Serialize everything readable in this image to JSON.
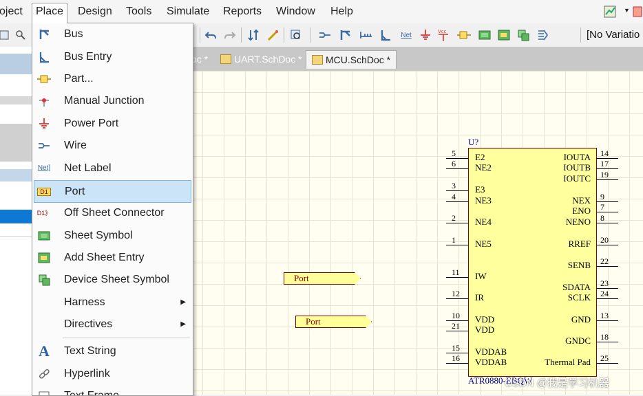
{
  "menubar": {
    "items": [
      "oject",
      "Place",
      "Design",
      "Tools",
      "Simulate",
      "Reports",
      "Window",
      "Help"
    ],
    "active": "Place"
  },
  "toolbar": {
    "variation_label": "[No Variatio"
  },
  "tabs": [
    {
      "label": "oc *",
      "active": false
    },
    {
      "label": "UART.SchDoc *",
      "active": false
    },
    {
      "label": "MCU.SchDoc *",
      "active": true
    }
  ],
  "place_menu": {
    "items": [
      {
        "label": "Bus",
        "icon": "bus-icon",
        "has_submenu": false
      },
      {
        "label": "Bus Entry",
        "icon": "bus-entry-icon",
        "has_submenu": false
      },
      {
        "label": "Part...",
        "icon": "part-icon",
        "has_submenu": false
      },
      {
        "label": "Manual Junction",
        "icon": "junction-icon",
        "has_submenu": false
      },
      {
        "label": "Power Port",
        "icon": "power-port-icon",
        "has_submenu": false
      },
      {
        "label": "Wire",
        "icon": "wire-icon",
        "has_submenu": false
      },
      {
        "label": "Net Label",
        "icon": "net-label-icon",
        "icon_text": "Net]",
        "has_submenu": false
      },
      {
        "label": "Port",
        "icon": "port-icon",
        "icon_text": "D1",
        "has_submenu": false,
        "highlighted": true
      },
      {
        "label": "Off Sheet Connector",
        "icon": "off-sheet-connector-icon",
        "icon_text": "D1》",
        "has_submenu": false
      },
      {
        "label": "Sheet Symbol",
        "icon": "sheet-symbol-icon",
        "has_submenu": false
      },
      {
        "label": "Add Sheet Entry",
        "icon": "sheet-entry-icon",
        "has_submenu": false
      },
      {
        "label": "Device Sheet Symbol",
        "icon": "device-sheet-symbol-icon",
        "has_submenu": false
      },
      {
        "label": "Harness",
        "icon": "",
        "has_submenu": true
      },
      {
        "label": "Directives",
        "icon": "",
        "has_submenu": true
      },
      {
        "label": "Text String",
        "icon": "text-string-icon",
        "icon_text": "A",
        "has_submenu": false
      },
      {
        "label": "Hyperlink",
        "icon": "hyperlink-icon",
        "has_submenu": false
      },
      {
        "label": "Text Frame",
        "icon": "text-frame-icon",
        "has_submenu": false
      }
    ]
  },
  "ports": [
    "Port",
    "Port"
  ],
  "component": {
    "designator": "U?",
    "part_name": "ATR0880-EBQW",
    "left_pins": [
      {
        "num": "5",
        "name": "E2"
      },
      {
        "num": "6",
        "name": "NE2"
      },
      {
        "num": "3",
        "name": "E3"
      },
      {
        "num": "4",
        "name": "NE3"
      },
      {
        "num": "2",
        "name": "NE4"
      },
      {
        "num": "1",
        "name": "NE5"
      },
      {
        "num": "11",
        "name": "IW"
      },
      {
        "num": "12",
        "name": "IR"
      },
      {
        "num": "10",
        "name": "VDD"
      },
      {
        "num": "21",
        "name": "VDD"
      },
      {
        "num": "15",
        "name": "VDDAB"
      },
      {
        "num": "16",
        "name": "VDDAB"
      }
    ],
    "right_pins": [
      {
        "num": "14",
        "name": "IOUTA"
      },
      {
        "num": "17",
        "name": "IOUTB"
      },
      {
        "num": "19",
        "name": "IOUTC"
      },
      {
        "num": "9",
        "name": "NEX"
      },
      {
        "num": "7",
        "name": "ENO"
      },
      {
        "num": "8",
        "name": "NENO"
      },
      {
        "num": "20",
        "name": "RREF"
      },
      {
        "num": "22",
        "name": "SENB"
      },
      {
        "num": "23",
        "name": "SDATA"
      },
      {
        "num": "24",
        "name": "SCLK"
      },
      {
        "num": "13",
        "name": "GND"
      },
      {
        "num": "18",
        "name": "GNDC"
      },
      {
        "num": "25",
        "name": "Thermal Pad"
      }
    ]
  },
  "watermark": "CSDN @我是学习机器",
  "colors": {
    "highlight": "#cce4f7",
    "component_fill": "#ffff9e",
    "border_red": "#8b0000",
    "designator_blue": "#00008b"
  }
}
